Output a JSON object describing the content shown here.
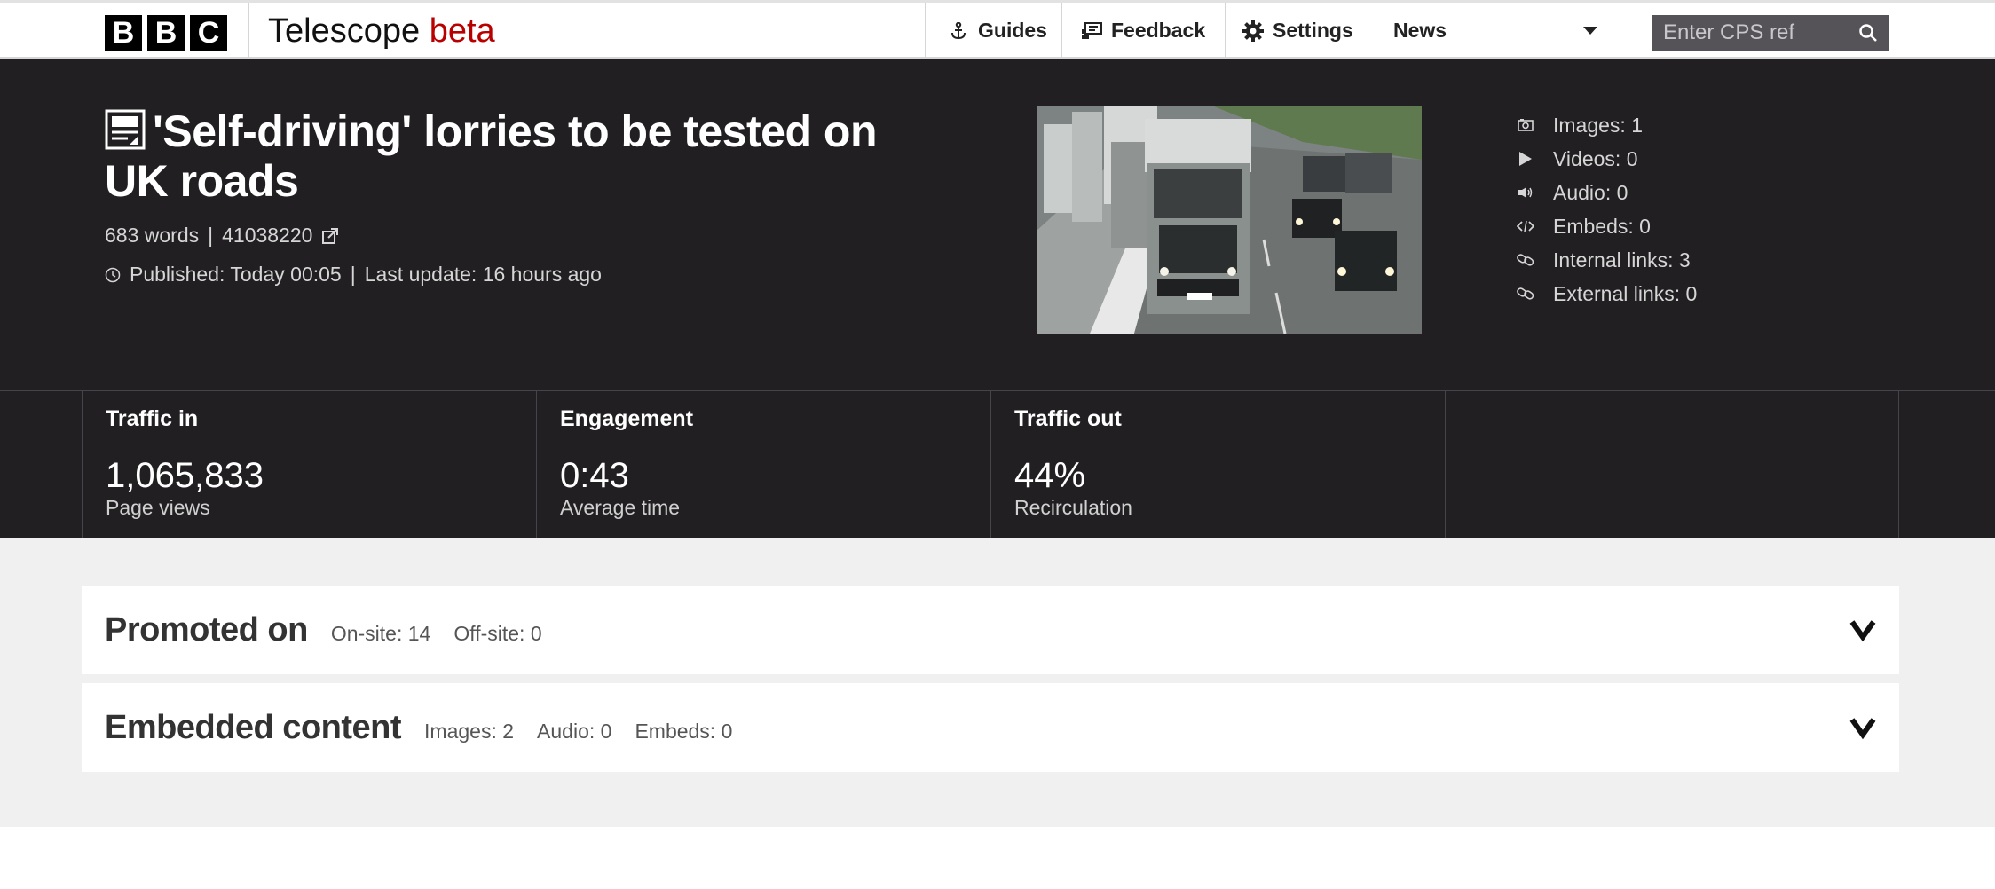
{
  "nav": {
    "logo_letters": [
      "B",
      "B",
      "C"
    ],
    "app_name": "Telescope",
    "app_tag": "beta",
    "links": [
      {
        "label": "Guides",
        "icon": "anchor-icon"
      },
      {
        "label": "Feedback",
        "icon": "feedback-icon"
      },
      {
        "label": "Settings",
        "icon": "gear-icon"
      }
    ],
    "section_select": "News",
    "search_placeholder": "Enter CPS ref"
  },
  "article": {
    "title": "'Self-driving' lorries to be tested on UK roads",
    "words": "683 words",
    "sep": "|",
    "id": "41038220",
    "published": "Published: Today 00:05",
    "last_update": "Last update: 16 hours ago",
    "image_alt": "Convoy of lorries on a motorway"
  },
  "asset_stats": [
    {
      "label": "Images: 1",
      "icon": "camera-icon"
    },
    {
      "label": "Videos: 0",
      "icon": "play-icon"
    },
    {
      "label": "Audio: 0",
      "icon": "speaker-icon"
    },
    {
      "label": "Embeds: 0",
      "icon": "code-icon"
    },
    {
      "label": "Internal links: 3",
      "icon": "link-icon"
    },
    {
      "label": "External links: 0",
      "icon": "link-icon"
    }
  ],
  "metrics": [
    {
      "title": "Traffic in",
      "value": "1,065,833",
      "label": "Page views"
    },
    {
      "title": "Engagement",
      "value": "0:43",
      "label": "Average time"
    },
    {
      "title": "Traffic out",
      "value": "44%",
      "label": "Recirculation"
    }
  ],
  "panels": [
    {
      "title": "Promoted on",
      "info": [
        "On-site: 14",
        "Off-site: 0"
      ]
    },
    {
      "title": "Embedded content",
      "info": [
        "Images: 2",
        "Audio: 0",
        "Embeds: 0"
      ]
    }
  ],
  "colors": {
    "accent": "#b80000",
    "dark_bg": "#221f22",
    "light_bg": "#f0f0f1"
  }
}
